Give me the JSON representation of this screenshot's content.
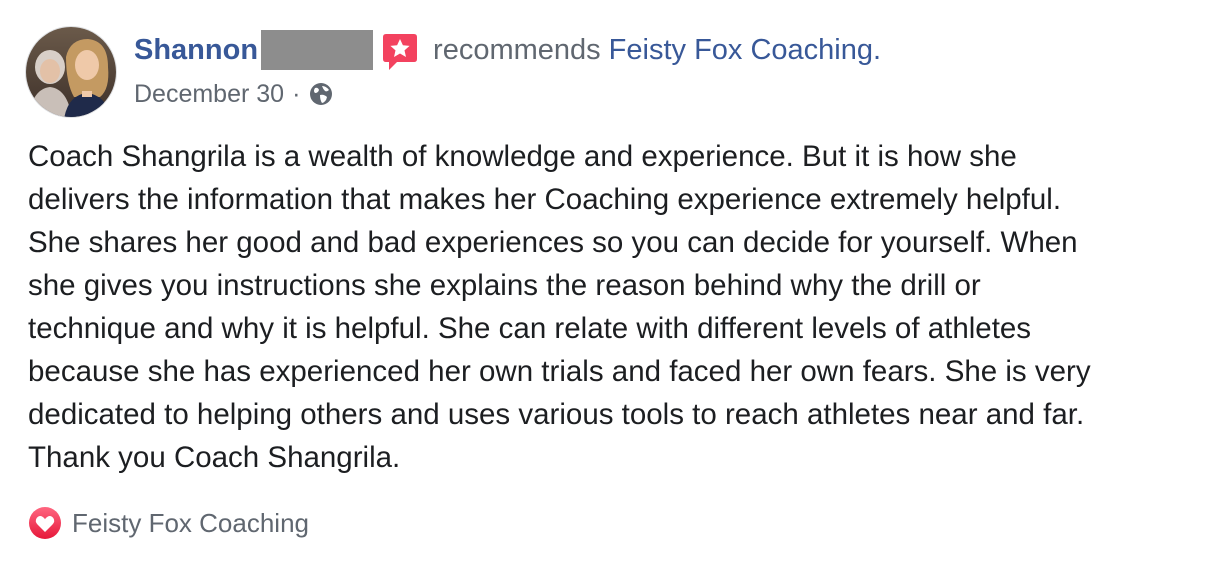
{
  "post": {
    "author": {
      "name": "Shannon",
      "surname_redacted": true
    },
    "action": "recommends",
    "page": {
      "name": "Feisty Fox Coaching."
    },
    "date": "December 30",
    "separator": "·",
    "privacy_icon": "globe-icon",
    "recommendation_icon": "recommendation-star-icon",
    "body_lines": [
      "Coach Shangrila is a wealth of knowledge and experience. But it is how she",
      "delivers the information that makes her Coaching experience extremely helpful.",
      "She shares her good and bad experiences so you can decide for yourself. When",
      "she gives you instructions she explains the reason behind why the drill or",
      "technique and why it is helpful. She can relate with different levels of athletes",
      "because she has experienced her own trials and faced her own fears. She is very",
      "dedicated to helping others and uses various tools to reach athletes near and far.",
      "Thank you Coach Shangrila."
    ],
    "reaction": {
      "icon": "heart-reaction-icon",
      "label": "Feisty Fox Coaching"
    }
  },
  "colors": {
    "link": "#385898",
    "secondary_text": "#606770",
    "body_text": "#1c1e21",
    "recommend_badge": "#f3425f",
    "heart_badge": "#f33e58",
    "redaction": "#8d8d8d"
  }
}
